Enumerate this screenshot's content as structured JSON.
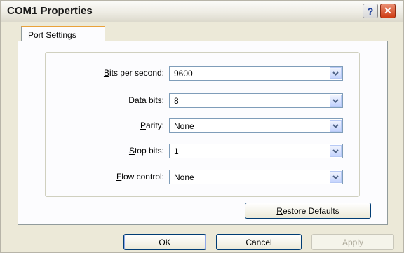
{
  "window": {
    "title": "COM1 Properties",
    "help_label": "?",
    "close_label": "✕"
  },
  "tabs": [
    {
      "label": "Port Settings",
      "selected": true
    }
  ],
  "fields": {
    "bits_per_second": {
      "label_accel": "B",
      "label_rest": "its per second:",
      "value": "9600"
    },
    "data_bits": {
      "label_accel": "D",
      "label_rest": "ata bits:",
      "value": "8"
    },
    "parity": {
      "label_accel": "P",
      "label_rest": "arity:",
      "value": "None"
    },
    "stop_bits": {
      "label_accel": "S",
      "label_rest": "top bits:",
      "value": "1"
    },
    "flow_control": {
      "label_accel": "F",
      "label_rest": "low control:",
      "value": "None"
    }
  },
  "buttons": {
    "restore_accel": "R",
    "restore_rest": "estore Defaults",
    "ok": "OK",
    "cancel": "Cancel",
    "apply": "Apply"
  },
  "icons": {
    "dropdown": "chevron-down-icon",
    "help": "help-icon",
    "close": "close-icon"
  }
}
